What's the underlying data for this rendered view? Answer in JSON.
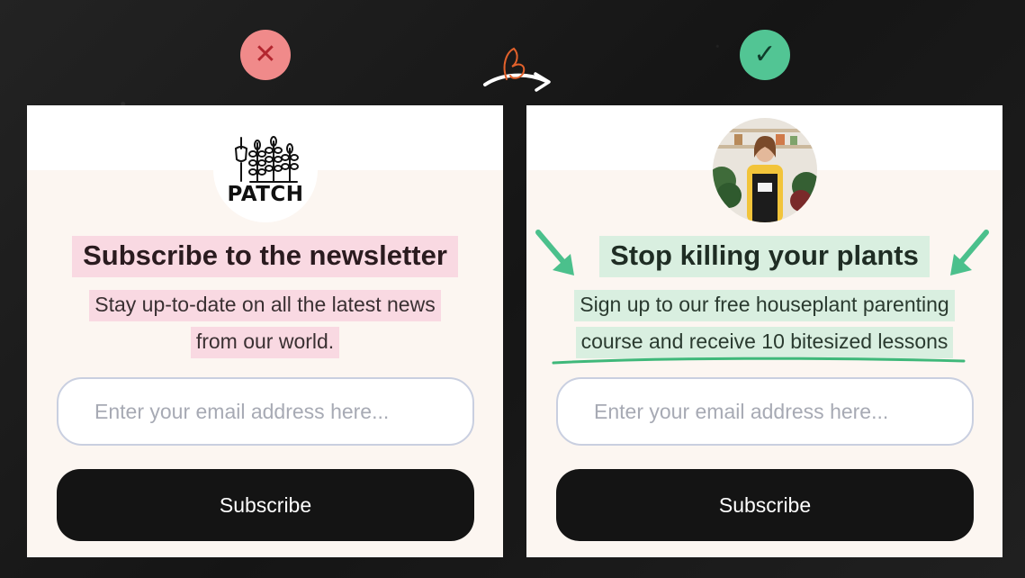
{
  "colors": {
    "bad_badge": "#f08a8a",
    "good_badge": "#52c594",
    "left_highlight": "#f9d9e2",
    "right_highlight": "#d9efe0",
    "button": "#141414",
    "arrow_green": "#4bc08c"
  },
  "badges": {
    "bad_icon": "close-icon",
    "bad_glyph": "✕",
    "good_icon": "check-icon",
    "good_glyph": "✓"
  },
  "left_card": {
    "logo_text": "PATCH",
    "headline": "Subscribe to the newsletter",
    "subline_1": "Stay up-to-date on all the latest news",
    "subline_2": "from our world.",
    "email_placeholder": "Enter your email address here...",
    "button_label": "Subscribe"
  },
  "right_card": {
    "avatar_icon": "person-photo",
    "headline": "Stop killing your plants",
    "subline_1": "Sign up to our free houseplant parenting",
    "subline_2": "course and receive 10 bitesized lessons",
    "email_placeholder": "Enter your email address here...",
    "button_label": "Subscribe"
  }
}
